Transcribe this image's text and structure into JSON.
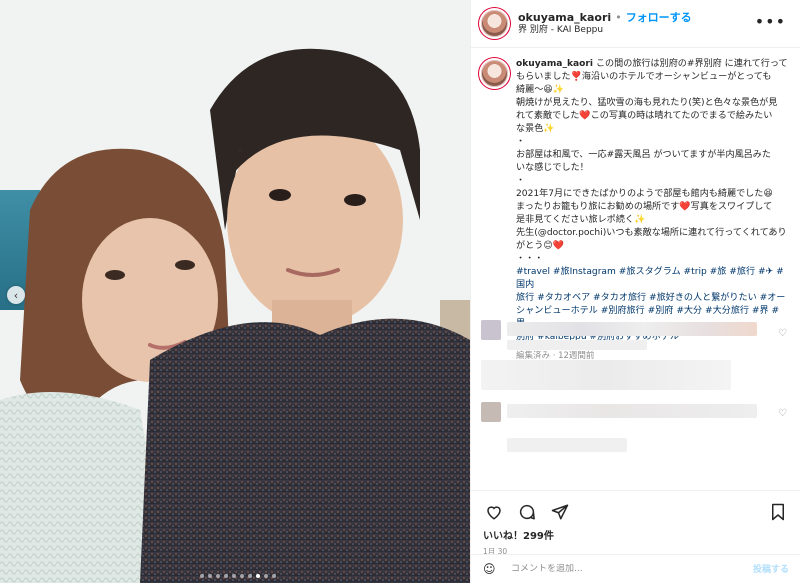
{
  "header": {
    "username": "okuyama_kaori",
    "separator": "•",
    "follow_label": "フォローする",
    "location": "界 別府 - KAI Beppu",
    "more_glyph": "•••"
  },
  "caption": {
    "username": "okuyama_kaori",
    "lines": [
      "この間の旅行は別府の#界別府 に連れて行って",
      "もらいました❣️海沿いのホテルでオーシャンビューがとっても",
      "綺麗〜😆✨",
      "朝焼けが見えたり、猛吹雪の海も見れたり(笑)と色々な景色が見",
      "れて素敵でした❤️この写真の時は晴れてたのでまるで絵みたい",
      "な景色✨",
      "・",
      "お部屋は和風で、一応#露天風呂 がついてますが半内風呂みた",
      "いな感じでした！",
      "・",
      "2021年7月にできたばかりのようで部屋も館内も綺麗でした😆",
      "まったりお籠もり旅にお勧めの場所です❤️写真をスワイプして",
      "是非見てください旅レポ続く✨",
      "先生(@doctor.pochi)いつも素敵な場所に連れて行ってくれてあり",
      "がとう😊❤️",
      "・・・"
    ],
    "hashtags": [
      "#travel #旅Instagram #旅スタグラム #trip #旅 #旅行 #✈ #国内",
      "旅行 #タカオベア #タカオ旅行 #旅好きの人と繋がりたい #オー",
      "シャンビューホテル #別府旅行 #別府 #大分 #大分旅行 #界 #界",
      "別府 #kaibeppu #別府おすすめホテル"
    ],
    "meta": "編集済み · 12週間前"
  },
  "actions": {
    "like_icon": "heart-icon",
    "comment_icon": "comment-icon",
    "share_icon": "paper-plane-icon",
    "save_icon": "bookmark-icon",
    "likes_text": "いいね！299件",
    "date": "1月 30"
  },
  "add_comment": {
    "emoji_icon": "smiley-icon",
    "placeholder": "コメントを追加...",
    "post_label": "投稿する"
  },
  "colors": {
    "link_blue": "#0095f6",
    "hashtag": "#00376b",
    "muted": "#8e8e8e",
    "post_disabled": "#b2dffc"
  }
}
